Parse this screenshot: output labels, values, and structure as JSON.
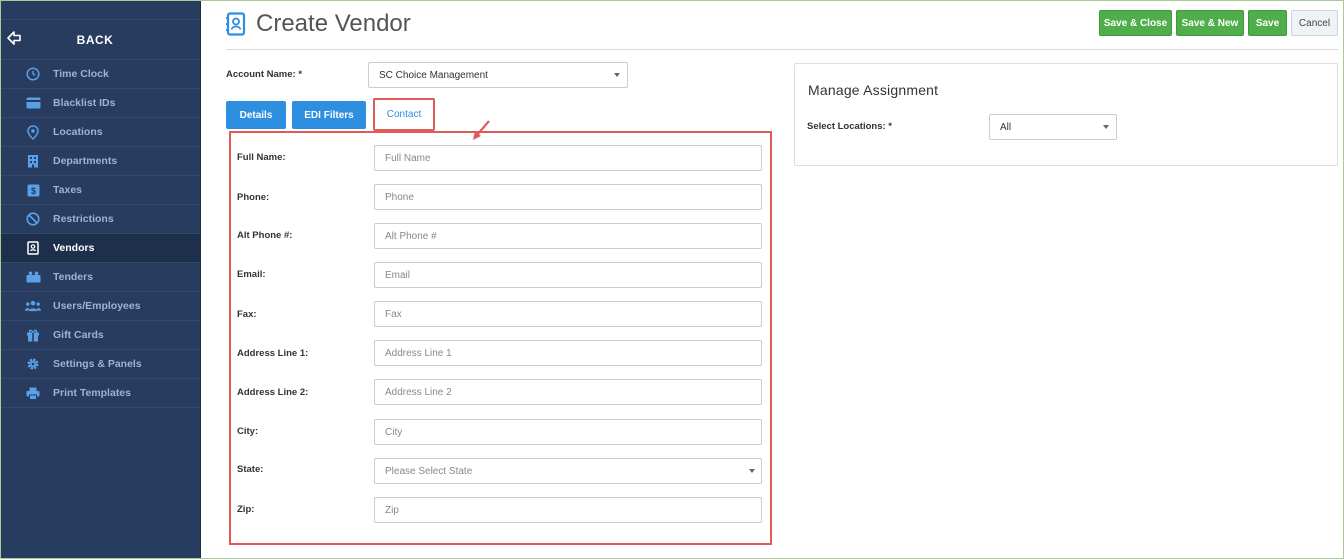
{
  "sidebar": {
    "back_label": "BACK",
    "items": [
      {
        "label": "Time Clock",
        "icon": "clock-icon"
      },
      {
        "label": "Blacklist IDs",
        "icon": "card-icon"
      },
      {
        "label": "Locations",
        "icon": "location-pin-icon"
      },
      {
        "label": "Departments",
        "icon": "building-icon"
      },
      {
        "label": "Taxes",
        "icon": "dollar-icon"
      },
      {
        "label": "Restrictions",
        "icon": "ban-icon"
      },
      {
        "label": "Vendors",
        "icon": "contact-book-icon",
        "active": true
      },
      {
        "label": "Tenders",
        "icon": "tender-icon"
      },
      {
        "label": "Users/Employees",
        "icon": "users-icon"
      },
      {
        "label": "Gift Cards",
        "icon": "gift-icon"
      },
      {
        "label": "Settings & Panels",
        "icon": "gear-icon"
      },
      {
        "label": "Print Templates",
        "icon": "printer-icon"
      }
    ]
  },
  "header": {
    "title": "Create Vendor",
    "buttons": {
      "save_close": "Save & Close",
      "save_new": "Save & New",
      "save": "Save",
      "cancel": "Cancel"
    }
  },
  "account": {
    "label": "Account Name: *",
    "value": "SC Choice Management"
  },
  "tabs": {
    "details": "Details",
    "edi_filters": "EDI Filters",
    "contact": "Contact"
  },
  "contact_form": {
    "fields": [
      {
        "label": "Full Name:",
        "placeholder": "Full Name"
      },
      {
        "label": "Phone:",
        "placeholder": "Phone"
      },
      {
        "label": "Alt Phone #:",
        "placeholder": "Alt Phone #"
      },
      {
        "label": "Email:",
        "placeholder": "Email"
      },
      {
        "label": "Fax:",
        "placeholder": "Fax"
      },
      {
        "label": "Address Line 1:",
        "placeholder": "Address Line 1"
      },
      {
        "label": "Address Line 2:",
        "placeholder": "Address Line 2"
      },
      {
        "label": "City:",
        "placeholder": "City"
      },
      {
        "label": "State:",
        "placeholder": "Please Select State"
      },
      {
        "label": "Zip:",
        "placeholder": "Zip"
      }
    ]
  },
  "assignment": {
    "title": "Manage Assignment",
    "locations_label": "Select Locations: *",
    "locations_value": "All"
  },
  "colors": {
    "sidebar_bg": "#273c5e",
    "green": "#4fae4a",
    "blue": "#2e8ee0",
    "highlight_red": "#e05a5a"
  }
}
